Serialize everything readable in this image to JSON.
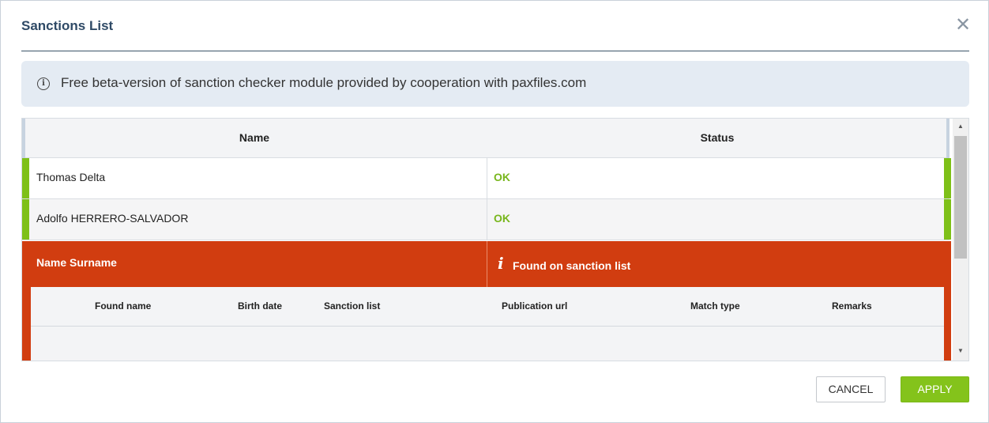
{
  "dialog": {
    "title": "Sanctions List",
    "close_glyph": "✕"
  },
  "info": {
    "icon": "info-icon",
    "text": "Free beta-version of sanction checker module provided by cooperation with paxfiles.com"
  },
  "table": {
    "headers": {
      "name": "Name",
      "status": "Status"
    },
    "rows": [
      {
        "name": "Thomas Delta",
        "status": "OK"
      },
      {
        "name": "Adolfo HERRERO-SALVADOR",
        "status": "OK"
      }
    ],
    "flagged": {
      "name": "Name Surname",
      "status": "Found on sanction list",
      "sub_headers": [
        "Found name",
        "Birth date",
        "Sanction list",
        "Publication url",
        "Match type",
        "Remarks"
      ]
    }
  },
  "buttons": {
    "cancel": "CANCEL",
    "apply": "APPLY"
  },
  "colors": {
    "ok": "#78b61c",
    "alert": "#d13d10",
    "apply": "#84c31b",
    "title": "#2f4a66"
  }
}
